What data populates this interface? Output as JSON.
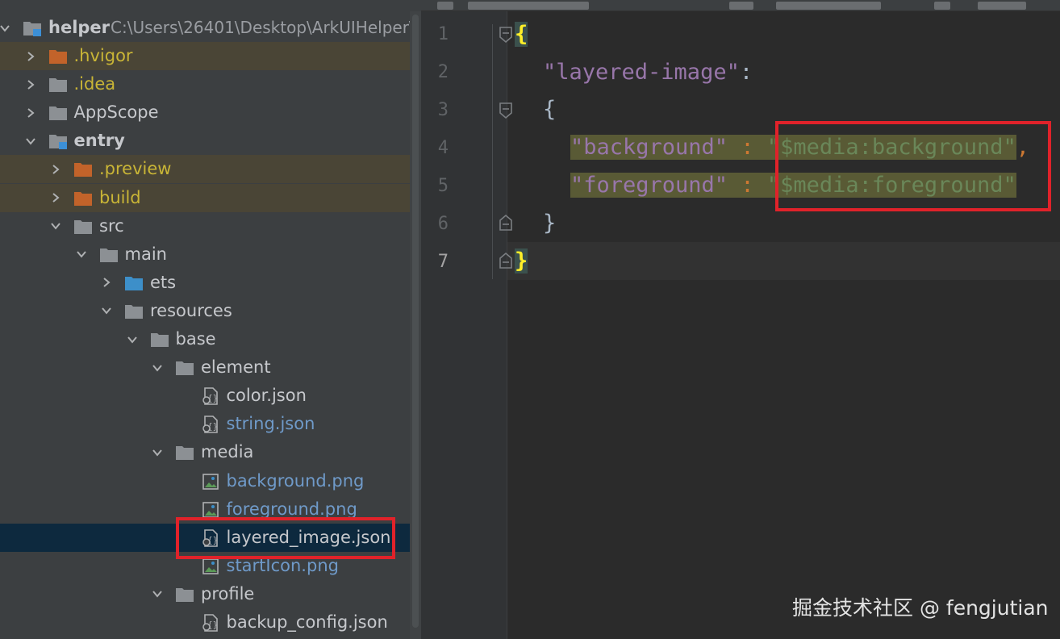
{
  "tree": {
    "root": {
      "label": "helper",
      "path": "C:\\Users\\26401\\Desktop\\ArkUIHelper\\"
    },
    "items": [
      {
        "label": ".hvigor",
        "kind": "folder-orange",
        "level": 1,
        "arrow": "right",
        "excluded": true
      },
      {
        "label": ".idea",
        "kind": "folder",
        "level": 1,
        "arrow": "right",
        "excluded": false
      },
      {
        "label": "AppScope",
        "kind": "folder",
        "level": 1,
        "arrow": "right",
        "excluded": false
      },
      {
        "label": "entry",
        "kind": "folder-module",
        "level": 1,
        "arrow": "down",
        "excluded": false
      },
      {
        "label": ".preview",
        "kind": "folder-orange",
        "level": 2,
        "arrow": "right",
        "excluded": true
      },
      {
        "label": "build",
        "kind": "folder-orange",
        "level": 2,
        "arrow": "right",
        "excluded": true
      },
      {
        "label": "src",
        "kind": "folder",
        "level": 2,
        "arrow": "down",
        "excluded": false
      },
      {
        "label": "main",
        "kind": "folder",
        "level": 3,
        "arrow": "down",
        "excluded": false
      },
      {
        "label": "ets",
        "kind": "folder-blue",
        "level": 4,
        "arrow": "right",
        "excluded": false
      },
      {
        "label": "resources",
        "kind": "folder",
        "level": 4,
        "arrow": "down",
        "excluded": false
      },
      {
        "label": "base",
        "kind": "folder",
        "level": 5,
        "arrow": "down",
        "excluded": false
      },
      {
        "label": "element",
        "kind": "folder",
        "level": 6,
        "arrow": "down",
        "excluded": false
      },
      {
        "label": "color.json",
        "kind": "json",
        "level": 7,
        "arrow": "none",
        "excluded": false
      },
      {
        "label": "string.json",
        "kind": "json",
        "level": 7,
        "arrow": "none",
        "excluded": false
      },
      {
        "label": "media",
        "kind": "folder",
        "level": 6,
        "arrow": "down",
        "excluded": false
      },
      {
        "label": "background.png",
        "kind": "image",
        "level": 7,
        "arrow": "none",
        "excluded": false
      },
      {
        "label": "foreground.png",
        "kind": "image",
        "level": 7,
        "arrow": "none",
        "excluded": false
      },
      {
        "label": "layered_image.json",
        "kind": "json",
        "level": 7,
        "arrow": "none",
        "excluded": false,
        "selected": true
      },
      {
        "label": "startIcon.png",
        "kind": "image",
        "level": 7,
        "arrow": "none",
        "excluded": false
      },
      {
        "label": "profile",
        "kind": "folder",
        "level": 6,
        "arrow": "down",
        "excluded": false
      },
      {
        "label": "backup_config.json",
        "kind": "json",
        "level": 7,
        "arrow": "none",
        "excluded": false
      }
    ]
  },
  "editor": {
    "line_numbers": [
      "1",
      "2",
      "3",
      "4",
      "5",
      "6",
      "7"
    ],
    "current_line": "7",
    "code": {
      "l1_open": "{",
      "l2_key": "\"layered-image\"",
      "l2_colon": ":",
      "l3_open": "{",
      "l4_key": "\"background\"",
      "l4_sep": " : ",
      "l4_val": "\"$media:background\"",
      "l4_comma": ",",
      "l5_key": "\"foreground\"",
      "l5_sep": " : ",
      "l5_val": "\"$media:foreground\"",
      "l6_close": "}",
      "l7_close": "}"
    }
  },
  "watermark": "掘金技术社区 @ fengjutian",
  "colors": {
    "tree_bg": "#3c3f41",
    "editor_bg": "#2b2b2b",
    "selection": "#0d293e",
    "excluded_bg": "#4a4536",
    "annotation_red": "#e0222a",
    "json_key": "#9876aa",
    "json_string": "#6a8759"
  }
}
